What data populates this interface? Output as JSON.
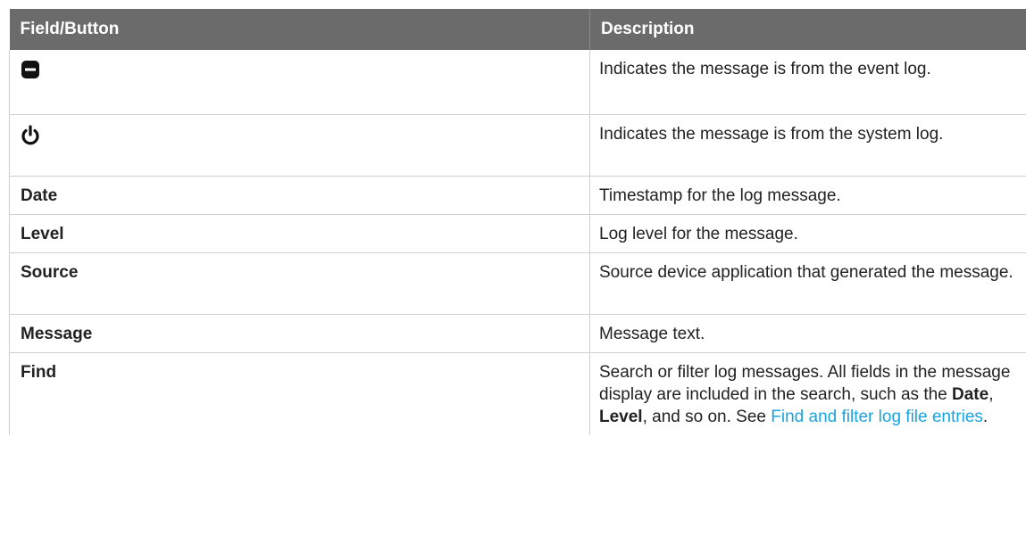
{
  "table": {
    "headers": [
      "Field/Button",
      "Description"
    ],
    "rows": [
      {
        "field": "",
        "icon": "event-log-icon",
        "description": "Indicates the message is from the event log."
      },
      {
        "field": "",
        "icon": "power-icon",
        "description": "Indicates the message is from the system log."
      },
      {
        "field": "Date",
        "description": "Timestamp for the log message."
      },
      {
        "field": "Level",
        "description": "Log level for the message."
      },
      {
        "field": "Source",
        "description": "Source device application that generated the message."
      },
      {
        "field": "Message",
        "description": "Message text."
      },
      {
        "field": "Find",
        "description_parts": {
          "before": "Search or filter log messages. All fields in the message display are included in the search, such as the ",
          "bold1": "Date",
          "between": ", ",
          "bold2": "Level",
          "after": ", and so on. See ",
          "link": "Find and filter log file entries",
          "end": "."
        }
      }
    ]
  }
}
